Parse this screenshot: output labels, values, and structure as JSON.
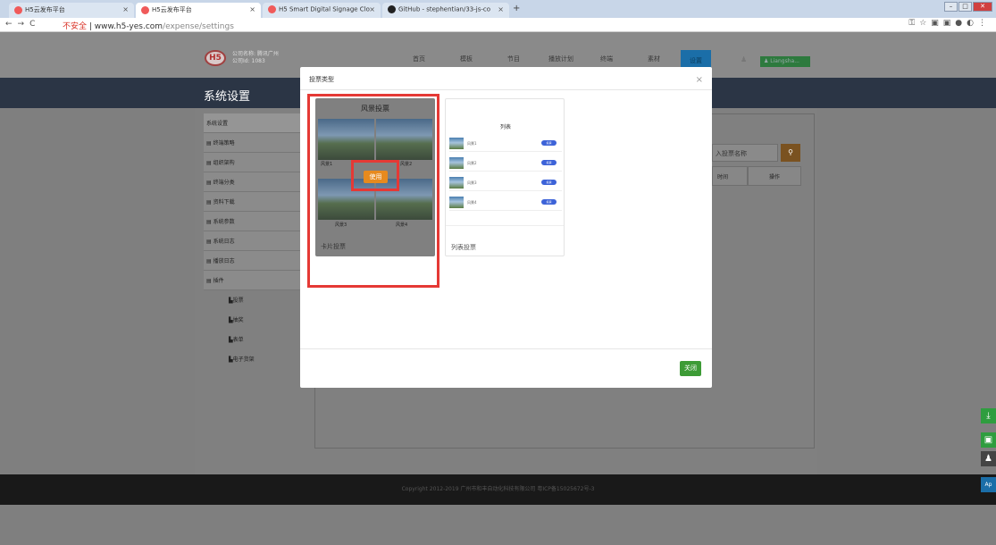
{
  "browser": {
    "tabs": [
      {
        "title": "H5云发布平台"
      },
      {
        "title": "H5云发布平台"
      },
      {
        "title": "H5 Smart Digital Signage Clo"
      },
      {
        "title": "GitHub - stephentian/33-js-co"
      }
    ],
    "security_label": "不安全",
    "url_host": "www.h5-yes.com",
    "url_path": "/expense/settings"
  },
  "header": {
    "logo_text": "H5",
    "company_name": "公司名称: 腾讯广州",
    "company_id": "公司Id: 1083",
    "nav": [
      "首页",
      "模板",
      "节目",
      "播放计划",
      "终端",
      "素材"
    ],
    "settings_label": "设置",
    "user_label": "Liangsha..."
  },
  "page": {
    "title": "系统设置"
  },
  "sidebar": {
    "header": "系统设置",
    "items": [
      "终端策略",
      "组织架构",
      "终端分类",
      "资料下载",
      "系统参数",
      "系统日志",
      "播放日志",
      "插件"
    ],
    "sub_items": [
      "投票",
      "抽奖",
      "表单",
      "电子货架"
    ]
  },
  "background_panel": {
    "search_placeholder": "入投票名称",
    "col_time": "时间",
    "col_action": "操作"
  },
  "modal": {
    "title": "投票类型",
    "card_vote": {
      "title": "风景投票",
      "labels": [
        "风景1",
        "风景2",
        "风景3",
        "风景4"
      ],
      "use_label": "使用",
      "footer": "卡片投票"
    },
    "list_vote": {
      "title": "列表",
      "footer": "列表投票",
      "rows": [
        {
          "label": "风景1",
          "btn": "投票"
        },
        {
          "label": "风景2",
          "btn": "投票"
        },
        {
          "label": "风景3",
          "btn": "投票"
        },
        {
          "label": "风景4",
          "btn": "投票"
        }
      ]
    },
    "close_label": "关闭"
  },
  "footer": {
    "copyright": "Copyright 2012-2019 广州市和丰自动化科技有限公司 粤ICP备15025672号-3"
  },
  "colors": {
    "highlight": "#e53935",
    "use_button": "#e78a1e",
    "close_button": "#3d9b36",
    "list_button": "#3d63d8"
  }
}
